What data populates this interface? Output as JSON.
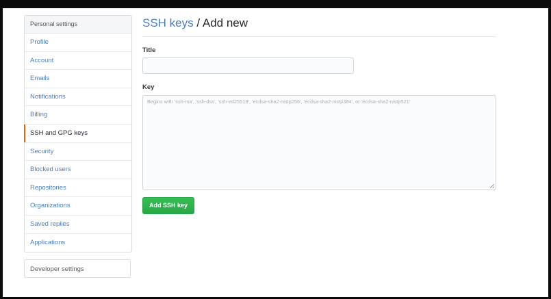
{
  "sidebar": {
    "heading": "Personal settings",
    "items": [
      {
        "label": "Profile",
        "selected": false
      },
      {
        "label": "Account",
        "selected": false
      },
      {
        "label": "Emails",
        "selected": false
      },
      {
        "label": "Notifications",
        "selected": false
      },
      {
        "label": "Billing",
        "selected": false
      },
      {
        "label": "SSH and GPG keys",
        "selected": true
      },
      {
        "label": "Security",
        "selected": false
      },
      {
        "label": "Blocked users",
        "selected": false
      },
      {
        "label": "Repositories",
        "selected": false
      },
      {
        "label": "Organizations",
        "selected": false
      },
      {
        "label": "Saved replies",
        "selected": false
      },
      {
        "label": "Applications",
        "selected": false
      }
    ],
    "developer_settings": "Developer settings"
  },
  "main": {
    "breadcrumb_link": "SSH keys",
    "breadcrumb_rest": " / Add new",
    "title_label": "Title",
    "title_value": "",
    "key_label": "Key",
    "key_placeholder": "Begins with 'ssh-rsa', 'ssh-dss', 'ssh-ed25519', 'ecdsa-sha2-nistp256', 'ecdsa-sha2-nistp384', or 'ecdsa-sha2-nistp521'",
    "key_value": "",
    "submit_label": "Add SSH key"
  },
  "colors": {
    "link": "#4a7fbf",
    "selected_indicator": "#e36209",
    "primary_button": "#28a745"
  }
}
